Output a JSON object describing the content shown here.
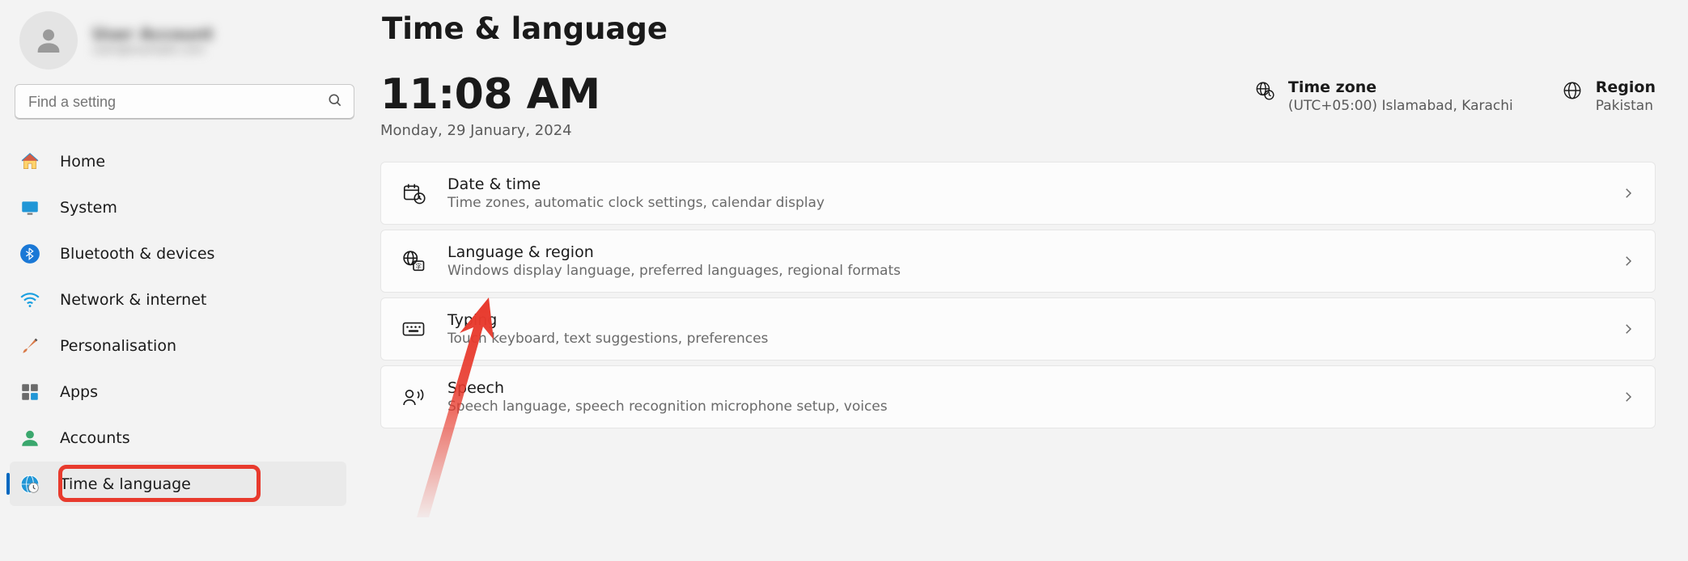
{
  "user": {
    "name": "User Account",
    "sub": "user@example.com"
  },
  "search": {
    "placeholder": "Find a setting"
  },
  "sidebar": {
    "items": [
      {
        "label": "Home",
        "active": false
      },
      {
        "label": "System",
        "active": false
      },
      {
        "label": "Bluetooth & devices",
        "active": false
      },
      {
        "label": "Network & internet",
        "active": false
      },
      {
        "label": "Personalisation",
        "active": false
      },
      {
        "label": "Apps",
        "active": false
      },
      {
        "label": "Accounts",
        "active": false
      },
      {
        "label": "Time & language",
        "active": true
      }
    ]
  },
  "page": {
    "title": "Time & language"
  },
  "clock": {
    "time": "11:08 AM",
    "date": "Monday, 29 January, 2024"
  },
  "timezone": {
    "label": "Time zone",
    "value": "(UTC+05:00) Islamabad, Karachi"
  },
  "region": {
    "label": "Region",
    "value": "Pakistan"
  },
  "cards": [
    {
      "title": "Date & time",
      "sub": "Time zones, automatic clock settings, calendar display"
    },
    {
      "title": "Language & region",
      "sub": "Windows display language, preferred languages, regional formats"
    },
    {
      "title": "Typing",
      "sub": "Touch keyboard, text suggestions, preferences"
    },
    {
      "title": "Speech",
      "sub": "Speech language, speech recognition microphone setup, voices"
    }
  ],
  "annotation": {
    "highlight_item": "Time & language",
    "arrow_target_card": "Language & region"
  }
}
